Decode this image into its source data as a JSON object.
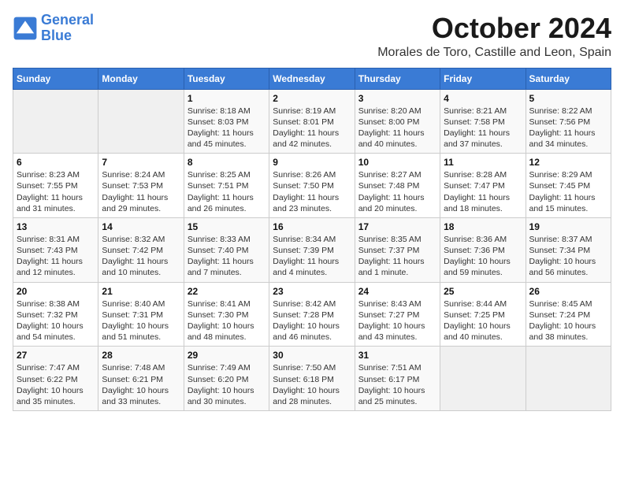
{
  "header": {
    "logo_line1": "General",
    "logo_line2": "Blue",
    "month": "October 2024",
    "location": "Morales de Toro, Castille and Leon, Spain"
  },
  "weekdays": [
    "Sunday",
    "Monday",
    "Tuesday",
    "Wednesday",
    "Thursday",
    "Friday",
    "Saturday"
  ],
  "weeks": [
    [
      {
        "day": "",
        "detail": ""
      },
      {
        "day": "",
        "detail": ""
      },
      {
        "day": "1",
        "detail": "Sunrise: 8:18 AM\nSunset: 8:03 PM\nDaylight: 11 hours and 45 minutes."
      },
      {
        "day": "2",
        "detail": "Sunrise: 8:19 AM\nSunset: 8:01 PM\nDaylight: 11 hours and 42 minutes."
      },
      {
        "day": "3",
        "detail": "Sunrise: 8:20 AM\nSunset: 8:00 PM\nDaylight: 11 hours and 40 minutes."
      },
      {
        "day": "4",
        "detail": "Sunrise: 8:21 AM\nSunset: 7:58 PM\nDaylight: 11 hours and 37 minutes."
      },
      {
        "day": "5",
        "detail": "Sunrise: 8:22 AM\nSunset: 7:56 PM\nDaylight: 11 hours and 34 minutes."
      }
    ],
    [
      {
        "day": "6",
        "detail": "Sunrise: 8:23 AM\nSunset: 7:55 PM\nDaylight: 11 hours and 31 minutes."
      },
      {
        "day": "7",
        "detail": "Sunrise: 8:24 AM\nSunset: 7:53 PM\nDaylight: 11 hours and 29 minutes."
      },
      {
        "day": "8",
        "detail": "Sunrise: 8:25 AM\nSunset: 7:51 PM\nDaylight: 11 hours and 26 minutes."
      },
      {
        "day": "9",
        "detail": "Sunrise: 8:26 AM\nSunset: 7:50 PM\nDaylight: 11 hours and 23 minutes."
      },
      {
        "day": "10",
        "detail": "Sunrise: 8:27 AM\nSunset: 7:48 PM\nDaylight: 11 hours and 20 minutes."
      },
      {
        "day": "11",
        "detail": "Sunrise: 8:28 AM\nSunset: 7:47 PM\nDaylight: 11 hours and 18 minutes."
      },
      {
        "day": "12",
        "detail": "Sunrise: 8:29 AM\nSunset: 7:45 PM\nDaylight: 11 hours and 15 minutes."
      }
    ],
    [
      {
        "day": "13",
        "detail": "Sunrise: 8:31 AM\nSunset: 7:43 PM\nDaylight: 11 hours and 12 minutes."
      },
      {
        "day": "14",
        "detail": "Sunrise: 8:32 AM\nSunset: 7:42 PM\nDaylight: 11 hours and 10 minutes."
      },
      {
        "day": "15",
        "detail": "Sunrise: 8:33 AM\nSunset: 7:40 PM\nDaylight: 11 hours and 7 minutes."
      },
      {
        "day": "16",
        "detail": "Sunrise: 8:34 AM\nSunset: 7:39 PM\nDaylight: 11 hours and 4 minutes."
      },
      {
        "day": "17",
        "detail": "Sunrise: 8:35 AM\nSunset: 7:37 PM\nDaylight: 11 hours and 1 minute."
      },
      {
        "day": "18",
        "detail": "Sunrise: 8:36 AM\nSunset: 7:36 PM\nDaylight: 10 hours and 59 minutes."
      },
      {
        "day": "19",
        "detail": "Sunrise: 8:37 AM\nSunset: 7:34 PM\nDaylight: 10 hours and 56 minutes."
      }
    ],
    [
      {
        "day": "20",
        "detail": "Sunrise: 8:38 AM\nSunset: 7:32 PM\nDaylight: 10 hours and 54 minutes."
      },
      {
        "day": "21",
        "detail": "Sunrise: 8:40 AM\nSunset: 7:31 PM\nDaylight: 10 hours and 51 minutes."
      },
      {
        "day": "22",
        "detail": "Sunrise: 8:41 AM\nSunset: 7:30 PM\nDaylight: 10 hours and 48 minutes."
      },
      {
        "day": "23",
        "detail": "Sunrise: 8:42 AM\nSunset: 7:28 PM\nDaylight: 10 hours and 46 minutes."
      },
      {
        "day": "24",
        "detail": "Sunrise: 8:43 AM\nSunset: 7:27 PM\nDaylight: 10 hours and 43 minutes."
      },
      {
        "day": "25",
        "detail": "Sunrise: 8:44 AM\nSunset: 7:25 PM\nDaylight: 10 hours and 40 minutes."
      },
      {
        "day": "26",
        "detail": "Sunrise: 8:45 AM\nSunset: 7:24 PM\nDaylight: 10 hours and 38 minutes."
      }
    ],
    [
      {
        "day": "27",
        "detail": "Sunrise: 7:47 AM\nSunset: 6:22 PM\nDaylight: 10 hours and 35 minutes."
      },
      {
        "day": "28",
        "detail": "Sunrise: 7:48 AM\nSunset: 6:21 PM\nDaylight: 10 hours and 33 minutes."
      },
      {
        "day": "29",
        "detail": "Sunrise: 7:49 AM\nSunset: 6:20 PM\nDaylight: 10 hours and 30 minutes."
      },
      {
        "day": "30",
        "detail": "Sunrise: 7:50 AM\nSunset: 6:18 PM\nDaylight: 10 hours and 28 minutes."
      },
      {
        "day": "31",
        "detail": "Sunrise: 7:51 AM\nSunset: 6:17 PM\nDaylight: 10 hours and 25 minutes."
      },
      {
        "day": "",
        "detail": ""
      },
      {
        "day": "",
        "detail": ""
      }
    ]
  ]
}
